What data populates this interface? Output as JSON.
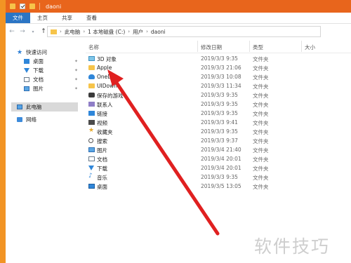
{
  "window": {
    "title": "daoni"
  },
  "ribbon": {
    "tabs": [
      "文件",
      "主页",
      "共享",
      "查看"
    ]
  },
  "address": {
    "crumbs": [
      "此电脑",
      "1 本地磁盘 (C:)",
      "用户",
      "daoni"
    ]
  },
  "sidebar": {
    "items": [
      {
        "label": "快速访问",
        "icon": "star-icon"
      },
      {
        "label": "桌面",
        "icon": "desktop-icon",
        "pinned": true
      },
      {
        "label": "下载",
        "icon": "download-icon",
        "pinned": true
      },
      {
        "label": "文档",
        "icon": "document-icon",
        "pinned": true
      },
      {
        "label": "图片",
        "icon": "picture-icon",
        "pinned": true
      },
      {
        "label": "此电脑",
        "icon": "computer-icon",
        "selected": true
      },
      {
        "label": "网络",
        "icon": "network-icon"
      }
    ]
  },
  "columns": {
    "name": "名称",
    "date": "修改日期",
    "type": "类型",
    "size": "大小"
  },
  "files": [
    {
      "name": "3D 对象",
      "date": "2019/3/3 9:35",
      "type": "文件夹",
      "icon": "3d-objects-icon"
    },
    {
      "name": "Apple",
      "date": "2019/3/3 21:06",
      "type": "文件夹",
      "icon": "folder-icon"
    },
    {
      "name": "OneDr",
      "date": "2019/3/3 10:08",
      "type": "文件夹",
      "icon": "onedrive-icon"
    },
    {
      "name": "UIDowne",
      "date": "2019/3/3 11:34",
      "type": "文件夹",
      "icon": "folder-icon"
    },
    {
      "name": "保存的游戏",
      "date": "2019/3/3 9:35",
      "type": "文件夹",
      "icon": "saved-games-icon"
    },
    {
      "name": "联系人",
      "date": "2019/3/3 9:35",
      "type": "文件夹",
      "icon": "contacts-icon"
    },
    {
      "name": "链接",
      "date": "2019/3/3 9:35",
      "type": "文件夹",
      "icon": "links-icon"
    },
    {
      "name": "视频",
      "date": "2019/3/3 9:41",
      "type": "文件夹",
      "icon": "videos-icon"
    },
    {
      "name": "收藏夹",
      "date": "2019/3/3 9:35",
      "type": "文件夹",
      "icon": "favorites-icon"
    },
    {
      "name": "搜索",
      "date": "2019/3/3 9:37",
      "type": "文件夹",
      "icon": "searches-icon"
    },
    {
      "name": "图片",
      "date": "2019/3/4 21:40",
      "type": "文件夹",
      "icon": "pictures-icon"
    },
    {
      "name": "文档",
      "date": "2019/3/4 20:01",
      "type": "文件夹",
      "icon": "documents-icon"
    },
    {
      "name": "下载",
      "date": "2019/3/4 20:01",
      "type": "文件夹",
      "icon": "downloads-icon"
    },
    {
      "name": "音乐",
      "date": "2019/3/3 9:35",
      "type": "文件夹",
      "icon": "music-icon"
    },
    {
      "name": "桌面",
      "date": "2019/3/5 13:05",
      "type": "文件夹",
      "icon": "desktop-icon"
    }
  ],
  "watermark": "软件技巧",
  "colors": {
    "titlebar": "#e8651c",
    "active_tab": "#2b75c4",
    "arrow": "#e02020"
  }
}
